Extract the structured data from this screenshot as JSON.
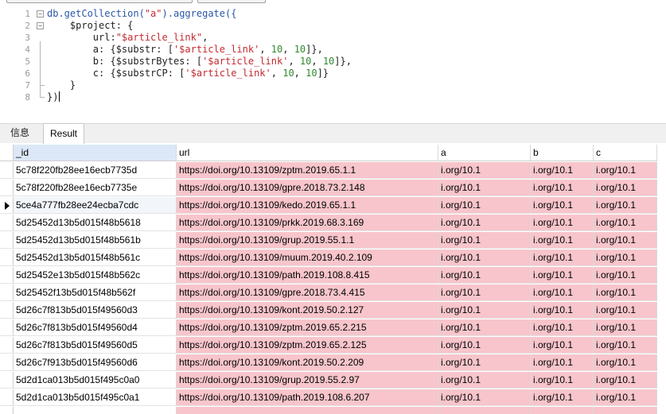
{
  "editor": {
    "lines": [
      {
        "n": "1",
        "tokens": [
          [
            "kw",
            "db.getCollection("
          ],
          [
            "str",
            "\"a\""
          ],
          [
            "kw",
            ").aggregate({"
          ]
        ]
      },
      {
        "n": "2",
        "tokens": [
          [
            "prop",
            "    $project: {"
          ]
        ]
      },
      {
        "n": "3",
        "tokens": [
          [
            "prop",
            "        url:"
          ],
          [
            "str",
            "\"$article_link\""
          ],
          [
            "prop",
            ","
          ]
        ]
      },
      {
        "n": "4",
        "tokens": [
          [
            "prop",
            "        a: {$substr: ["
          ],
          [
            "str",
            "'$article_link'"
          ],
          [
            "prop",
            ", "
          ],
          [
            "num",
            "10"
          ],
          [
            "prop",
            ", "
          ],
          [
            "num",
            "10"
          ],
          [
            "prop",
            "]},"
          ]
        ]
      },
      {
        "n": "5",
        "tokens": [
          [
            "prop",
            "        b: {$substrBytes: ["
          ],
          [
            "str",
            "'$article_link'"
          ],
          [
            "prop",
            ", "
          ],
          [
            "num",
            "10"
          ],
          [
            "prop",
            ", "
          ],
          [
            "num",
            "10"
          ],
          [
            "prop",
            "]},"
          ]
        ]
      },
      {
        "n": "6",
        "tokens": [
          [
            "prop",
            "        c: {$substrCP: ["
          ],
          [
            "str",
            "'$article_link'"
          ],
          [
            "prop",
            ", "
          ],
          [
            "num",
            "10"
          ],
          [
            "prop",
            ", "
          ],
          [
            "num",
            "10"
          ],
          [
            "prop",
            "]}"
          ]
        ]
      },
      {
        "n": "7",
        "tokens": [
          [
            "prop",
            "    }"
          ]
        ]
      },
      {
        "n": "8",
        "tokens": [
          [
            "prop",
            "})"
          ]
        ]
      }
    ]
  },
  "tabs": {
    "info": "信息",
    "result": "Result"
  },
  "grid": {
    "columns": {
      "id": "_id",
      "url": "url",
      "a": "a",
      "b": "b",
      "c": "c"
    },
    "rows": [
      {
        "id": "5c78f220fb28ee16ecb7735d",
        "url": "https://doi.org/10.13109/zptm.2019.65.1.1",
        "a": "i.org/10.1",
        "b": "i.org/10.1",
        "c": "i.org/10.1"
      },
      {
        "id": "5c78f220fb28ee16ecb7735e",
        "url": "https://doi.org/10.13109/gpre.2018.73.2.148",
        "a": "i.org/10.1",
        "b": "i.org/10.1",
        "c": "i.org/10.1"
      },
      {
        "id": "5ce4a777fb28ee24ecba7cdc",
        "url": "https://doi.org/10.13109/kedo.2019.65.1.1",
        "a": "i.org/10.1",
        "b": "i.org/10.1",
        "c": "i.org/10.1",
        "selected": true
      },
      {
        "id": "5d25452d13b5d015f48b5618",
        "url": "https://doi.org/10.13109/prkk.2019.68.3.169",
        "a": "i.org/10.1",
        "b": "i.org/10.1",
        "c": "i.org/10.1"
      },
      {
        "id": "5d25452d13b5d015f48b561b",
        "url": "https://doi.org/10.13109/grup.2019.55.1.1",
        "a": "i.org/10.1",
        "b": "i.org/10.1",
        "c": "i.org/10.1"
      },
      {
        "id": "5d25452d13b5d015f48b561c",
        "url": "https://doi.org/10.13109/muum.2019.40.2.109",
        "a": "i.org/10.1",
        "b": "i.org/10.1",
        "c": "i.org/10.1"
      },
      {
        "id": "5d25452e13b5d015f48b562c",
        "url": "https://doi.org/10.13109/path.2019.108.8.415",
        "a": "i.org/10.1",
        "b": "i.org/10.1",
        "c": "i.org/10.1"
      },
      {
        "id": "5d25452f13b5d015f48b562f",
        "url": "https://doi.org/10.13109/gpre.2018.73.4.415",
        "a": "i.org/10.1",
        "b": "i.org/10.1",
        "c": "i.org/10.1"
      },
      {
        "id": "5d26c7f813b5d015f49560d3",
        "url": "https://doi.org/10.13109/kont.2019.50.2.127",
        "a": "i.org/10.1",
        "b": "i.org/10.1",
        "c": "i.org/10.1"
      },
      {
        "id": "5d26c7f813b5d015f49560d4",
        "url": "https://doi.org/10.13109/zptm.2019.65.2.215",
        "a": "i.org/10.1",
        "b": "i.org/10.1",
        "c": "i.org/10.1"
      },
      {
        "id": "5d26c7f813b5d015f49560d5",
        "url": "https://doi.org/10.13109/zptm.2019.65.2.125",
        "a": "i.org/10.1",
        "b": "i.org/10.1",
        "c": "i.org/10.1"
      },
      {
        "id": "5d26c7f913b5d015f49560d6",
        "url": "https://doi.org/10.13109/kont.2019.50.2.209",
        "a": "i.org/10.1",
        "b": "i.org/10.1",
        "c": "i.org/10.1"
      },
      {
        "id": "5d2d1ca013b5d015f495c0a0",
        "url": "https://doi.org/10.13109/grup.2019.55.2.97",
        "a": "i.org/10.1",
        "b": "i.org/10.1",
        "c": "i.org/10.1"
      },
      {
        "id": "5d2d1ca013b5d015f495c0a1",
        "url": "https://doi.org/10.13109/path.2019.108.6.207",
        "a": "i.org/10.1",
        "b": "i.org/10.1",
        "c": "i.org/10.1"
      },
      {
        "id": "",
        "url": "",
        "a": "",
        "b": "",
        "c": ""
      }
    ]
  }
}
